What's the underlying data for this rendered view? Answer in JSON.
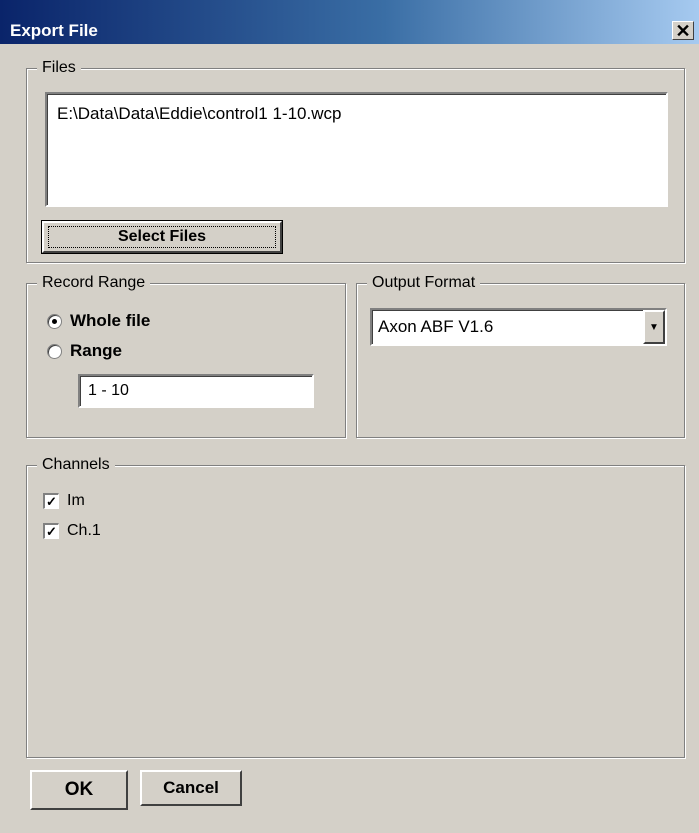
{
  "window": {
    "title": "Export File",
    "close_glyph": "✕"
  },
  "files": {
    "legend": "Files",
    "items": [
      "E:\\Data\\Data\\Eddie\\control1 1-10.wcp"
    ],
    "select_button": "Select Files"
  },
  "record_range": {
    "legend": "Record Range",
    "whole_file_label": "Whole file",
    "range_label": "Range",
    "selected": "Whole file",
    "range_value": "1 - 10"
  },
  "output_format": {
    "legend": "Output  Format",
    "selected": "Axon ABF V1.6",
    "arrow_glyph": "▼"
  },
  "channels": {
    "legend": "Channels",
    "items": [
      {
        "label": "Im",
        "checked": true,
        "mark": "✓"
      },
      {
        "label": "Ch.1",
        "checked": true,
        "mark": "✓"
      }
    ]
  },
  "buttons": {
    "ok": "OK",
    "cancel": "Cancel"
  }
}
